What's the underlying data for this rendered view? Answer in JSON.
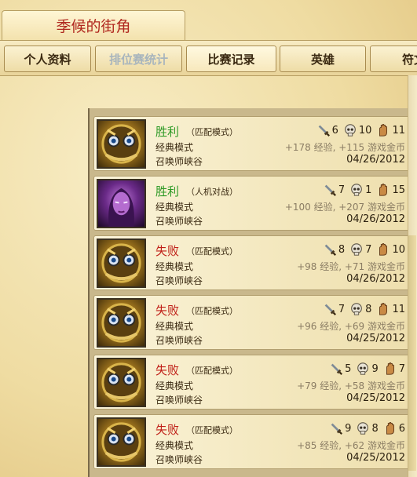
{
  "header": {
    "title": "季候的街角"
  },
  "tabs": [
    {
      "label": "个人资料",
      "state": "normal"
    },
    {
      "label": "排位赛统计",
      "state": "disabled"
    },
    {
      "label": "比赛记录",
      "state": "active"
    },
    {
      "label": "英雄",
      "state": "normal"
    },
    {
      "label": "符文",
      "state": "normal"
    }
  ],
  "matches": [
    {
      "result": "胜利",
      "mode": "（匹配模式）",
      "type": "经典模式",
      "map": "召唤师峡谷",
      "kills": "6",
      "deaths": "10",
      "assists": "11",
      "reward": "+178 经验, +115 游戏金币",
      "date": "04/26/2012",
      "avatar": "gold"
    },
    {
      "result": "胜利",
      "mode": "（人机对战）",
      "type": "经典模式",
      "map": "召唤师峡谷",
      "kills": "7",
      "deaths": "1",
      "assists": "15",
      "reward": "+100 经验, +207 游戏金币",
      "date": "04/26/2012",
      "avatar": "purple"
    },
    {
      "result": "失败",
      "mode": "（匹配模式）",
      "type": "经典模式",
      "map": "召唤师峡谷",
      "kills": "8",
      "deaths": "7",
      "assists": "10",
      "reward": "+98 经验, +71 游戏金币",
      "date": "04/26/2012",
      "avatar": "gold"
    },
    {
      "result": "失败",
      "mode": "（匹配模式）",
      "type": "经典模式",
      "map": "召唤师峡谷",
      "kills": "7",
      "deaths": "8",
      "assists": "11",
      "reward": "+96 经验, +69 游戏金币",
      "date": "04/25/2012",
      "avatar": "gold"
    },
    {
      "result": "失败",
      "mode": "（匹配模式）",
      "type": "经典模式",
      "map": "召唤师峡谷",
      "kills": "5",
      "deaths": "9",
      "assists": "7",
      "reward": "+79 经验, +58 游戏金币",
      "date": "04/25/2012",
      "avatar": "gold"
    },
    {
      "result": "失败",
      "mode": "（匹配模式）",
      "type": "经典模式",
      "map": "召唤师峡谷",
      "kills": "9",
      "deaths": "8",
      "assists": "6",
      "reward": "+85 经验, +62 游戏金币",
      "date": "04/25/2012",
      "avatar": "gold"
    }
  ]
}
